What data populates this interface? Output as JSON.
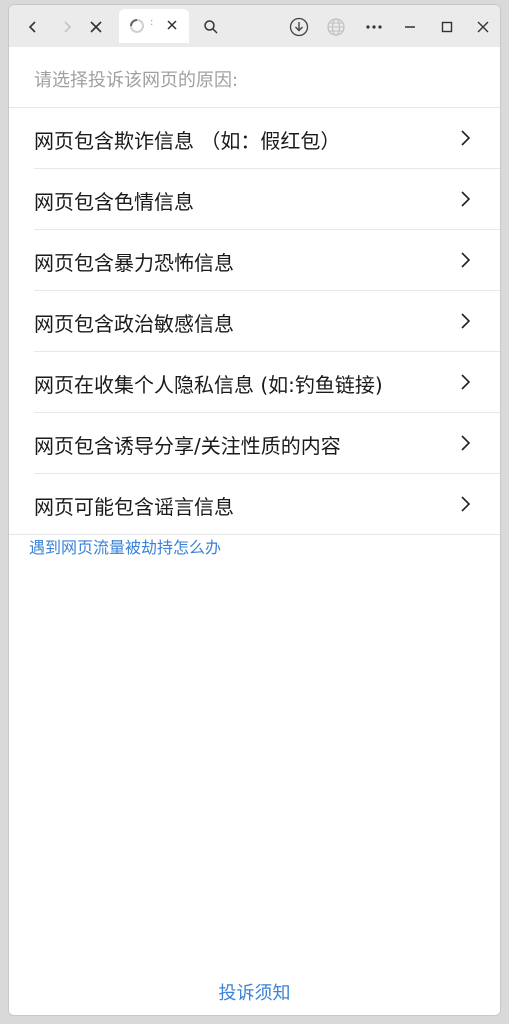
{
  "browser": {
    "tab_dots": ":",
    "icons": {
      "back": "chevron-left-icon",
      "forward": "chevron-right-icon",
      "stop": "close-icon",
      "search": "search-icon",
      "download": "download-icon",
      "globe": "globe-icon",
      "more": "more-icon",
      "minimize": "minimize-icon",
      "maximize": "maximize-icon",
      "close": "close-icon"
    }
  },
  "report": {
    "prompt": "请选择投诉该网页的原因:",
    "reasons": [
      {
        "label": "网页包含欺诈信息 （如：假红包）"
      },
      {
        "label": "网页包含色情信息"
      },
      {
        "label": "网页包含暴力恐怖信息"
      },
      {
        "label": "网页包含政治敏感信息"
      },
      {
        "label": "网页在收集个人隐私信息 (如:钓鱼链接)"
      },
      {
        "label": "网页包含诱导分享/关注性质的内容"
      },
      {
        "label": "网页可能包含谣言信息"
      }
    ],
    "hijack_link": "遇到网页流量被劫持怎么办",
    "notice_link": "投诉须知"
  },
  "colors": {
    "link": "#3b82d6",
    "titlebar": "#ebebeb",
    "prompt_text": "#a0a0a0"
  }
}
